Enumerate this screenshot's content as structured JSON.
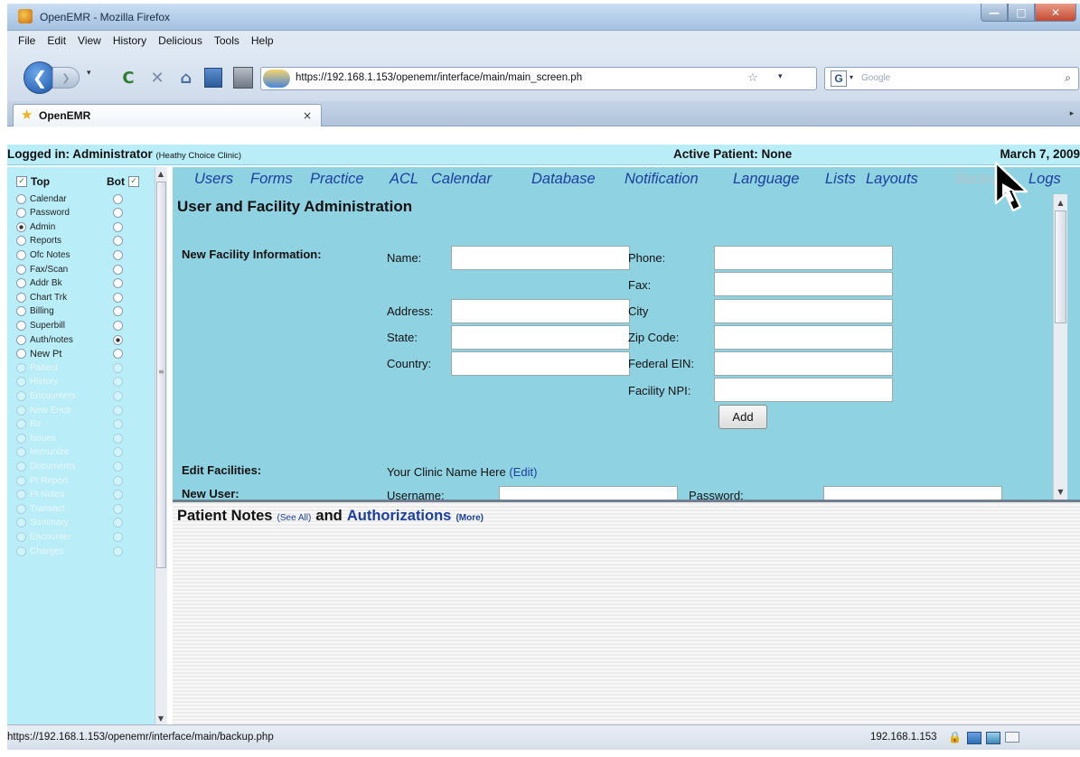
{
  "window": {
    "title": "OpenEMR - Mozilla Firefox",
    "minimize_glyph": "—",
    "maximize_glyph": "□",
    "close_glyph": "✕"
  },
  "menubar": {
    "items": [
      "File",
      "Edit",
      "View",
      "History",
      "Delicious",
      "Tools",
      "Help"
    ]
  },
  "toolbar": {
    "back_glyph": "❮",
    "forward_glyph": "❯",
    "dropdown_glyph": "▾",
    "reload_glyph": "C",
    "stop_glyph": "✕",
    "home_glyph": "⌂",
    "url": "https://192.168.1.153/openemr/interface/main/main_screen.ph",
    "bookmark_star_glyph": "☆",
    "search_engine_letter": "G",
    "search_placeholder": "Google",
    "search_glyph": "⌕"
  },
  "tab": {
    "label": "OpenEMR",
    "icon_glyph": "★",
    "close_glyph": "×",
    "scroll_glyph": "▸"
  },
  "emr_header": {
    "logged_in": "Logged in: Administrator",
    "clinic": "(Heathy Choice Clinic)",
    "active_patient": "Active Patient: None",
    "date": "March 7, 2009"
  },
  "leftnav": {
    "top_label": "Top",
    "bot_label": "Bot",
    "check_glyph": "✓",
    "items": [
      {
        "label": "Calendar",
        "dim": false,
        "top": "off",
        "bot": "off"
      },
      {
        "label": "Password",
        "dim": false,
        "top": "off",
        "bot": "off"
      },
      {
        "label": "Admin",
        "dim": false,
        "top": "sel",
        "bot": "off"
      },
      {
        "label": "Reports",
        "dim": false,
        "top": "off",
        "bot": "off"
      },
      {
        "label": "Ofc Notes",
        "dim": false,
        "top": "off",
        "bot": "off"
      },
      {
        "label": "Fax/Scan",
        "dim": false,
        "top": "off",
        "bot": "off"
      },
      {
        "label": "Addr Bk",
        "dim": false,
        "top": "off",
        "bot": "off"
      },
      {
        "label": "Chart Trk",
        "dim": false,
        "top": "off",
        "bot": "off"
      },
      {
        "label": "Billing",
        "dim": false,
        "top": "off",
        "bot": "off"
      },
      {
        "label": "Superbill",
        "dim": false,
        "top": "off",
        "bot": "off"
      },
      {
        "label": "Auth/notes",
        "dim": false,
        "top": "off",
        "bot": "sel"
      },
      {
        "label": "New Pt",
        "dim": false,
        "top": "off",
        "bot": "off"
      },
      {
        "label": "Patient",
        "dim": true,
        "top": "faded",
        "bot": "faded"
      },
      {
        "label": "History",
        "dim": true,
        "top": "faded",
        "bot": "faded"
      },
      {
        "label": "Encounters",
        "dim": true,
        "top": "faded",
        "bot": "faded"
      },
      {
        "label": "New Enctr",
        "dim": true,
        "top": "faded",
        "bot": "faded"
      },
      {
        "label": "Rx",
        "dim": true,
        "top": "faded",
        "bot": "faded"
      },
      {
        "label": "Issues",
        "dim": true,
        "top": "faded",
        "bot": "faded"
      },
      {
        "label": "Immunize",
        "dim": true,
        "top": "faded",
        "bot": "faded"
      },
      {
        "label": "Documents",
        "dim": true,
        "top": "faded",
        "bot": "faded"
      },
      {
        "label": "Pt Report",
        "dim": true,
        "top": "faded",
        "bot": "faded"
      },
      {
        "label": "Pt Notes",
        "dim": true,
        "top": "faded",
        "bot": "faded"
      },
      {
        "label": "Transact",
        "dim": true,
        "top": "faded",
        "bot": "faded"
      },
      {
        "label": "Summary",
        "dim": true,
        "top": "faded",
        "bot": "faded"
      },
      {
        "label": "Encounter",
        "dim": true,
        "top": "faded",
        "bot": "faded"
      },
      {
        "label": "Charges",
        "dim": true,
        "top": "faded",
        "bot": "faded"
      }
    ],
    "scroll_up_glyph": "▲",
    "scroll_down_glyph": "▼",
    "grip_glyph": "≡"
  },
  "admin_menu": {
    "items": [
      {
        "label": "Users",
        "disabled": false
      },
      {
        "label": "Forms",
        "disabled": false
      },
      {
        "label": "Practice",
        "disabled": false
      },
      {
        "label": "ACL",
        "disabled": false
      },
      {
        "label": "Calendar",
        "disabled": false
      },
      {
        "label": "Database",
        "disabled": false
      },
      {
        "label": "Notification",
        "disabled": false
      },
      {
        "label": "Language",
        "disabled": false
      },
      {
        "label": "Lists",
        "disabled": false
      },
      {
        "label": "Layouts",
        "disabled": false
      },
      {
        "label": "Backup",
        "disabled": true
      },
      {
        "label": "Logs",
        "disabled": false
      }
    ]
  },
  "main": {
    "title": "User and Facility Administration",
    "new_facility_label": "New Facility Information:",
    "fields": {
      "name": "Name:",
      "address": "Address:",
      "state": "State:",
      "country": "Country:",
      "phone": "Phone:",
      "fax": "Fax:",
      "city": "City",
      "zip": "Zip Code:",
      "federal_ein": "Federal EIN:",
      "facility_npi": "Facility NPI:"
    },
    "add_button": "Add",
    "edit_facilities_label": "Edit Facilities:",
    "clinic_name": "Your Clinic Name Here",
    "edit_link": "(Edit)",
    "new_user_label": "New User:",
    "username_label": "Username:",
    "password_label": "Password:",
    "scroll_up_glyph": "▲",
    "scroll_down_glyph": "▼"
  },
  "notes": {
    "title_part1": "Patient Notes",
    "see_all": "(See All)",
    "and": "and",
    "authorizations": "Authorizations",
    "more": "(More)"
  },
  "statusbar": {
    "url": "https://192.168.1.153/openemr/interface/main/backup.php",
    "ip": "192.168.1.153",
    "lock_glyph": "🔒"
  }
}
